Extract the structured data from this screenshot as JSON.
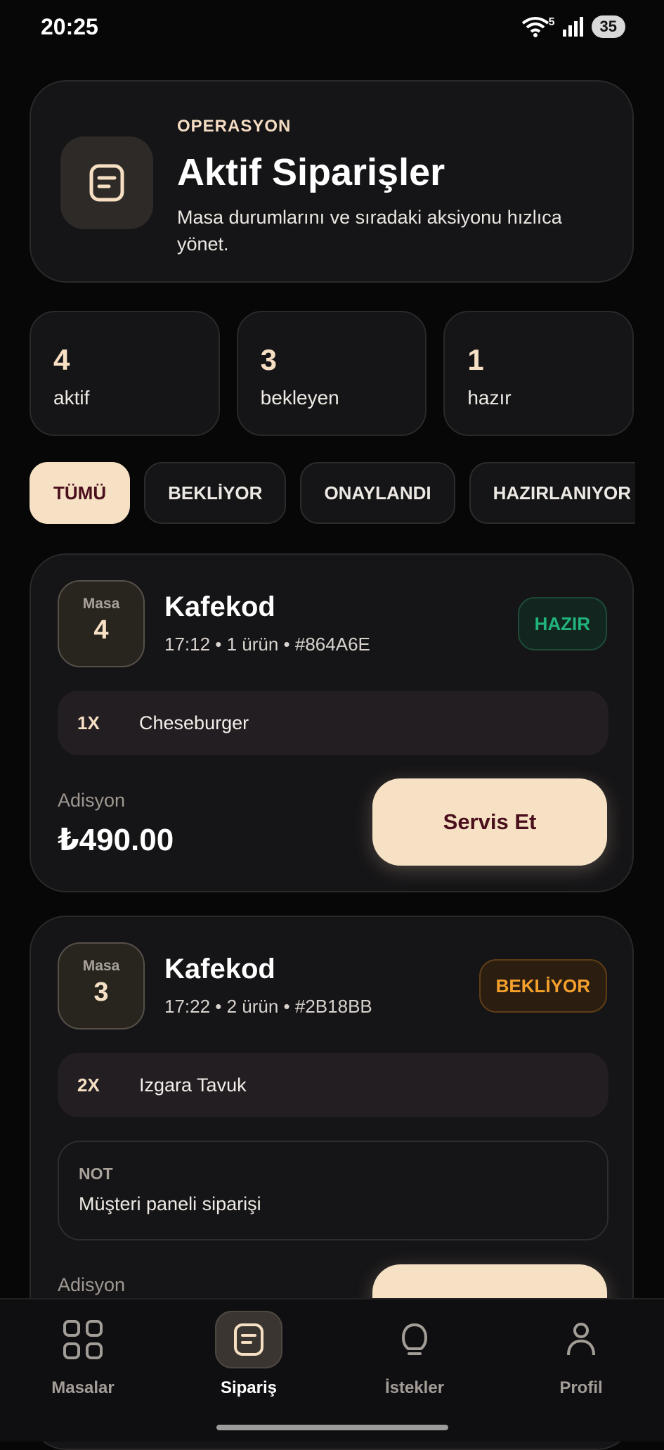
{
  "status_bar": {
    "time": "20:25",
    "network": "5",
    "battery": "35"
  },
  "header": {
    "eyebrow": "OPERASYON",
    "title": "Aktif Siparişler",
    "subtitle": "Masa durumlarını ve sıradaki aksiyonu hızlıca yönet."
  },
  "stats": [
    {
      "value": "4",
      "label": "aktif"
    },
    {
      "value": "3",
      "label": "bekleyen"
    },
    {
      "value": "1",
      "label": "hazır"
    }
  ],
  "filters": [
    {
      "label": "TÜMÜ",
      "active": true
    },
    {
      "label": "BEKLİYOR",
      "active": false
    },
    {
      "label": "ONAYLANDI",
      "active": false
    },
    {
      "label": "HAZIRLANIYOR",
      "active": false
    }
  ],
  "orders": [
    {
      "table_label": "Masa",
      "table_number": "4",
      "name": "Kafekod",
      "meta": "17:12 • 1 ürün • #864A6E",
      "status": "HAZIR",
      "items": [
        {
          "qty": "1X",
          "name": "Cheseburger"
        }
      ],
      "bill_label": "Adisyon",
      "total": "₺490.00",
      "action": "Servis Et"
    },
    {
      "table_label": "Masa",
      "table_number": "3",
      "name": "Kafekod",
      "meta": "17:22 • 2 ürün • #2B18BB",
      "status": "BEKLİYOR",
      "items": [
        {
          "qty": "2X",
          "name": "Izgara Tavuk"
        }
      ],
      "note_label": "NOT",
      "note": "Müşteri paneli siparişi",
      "bill_label": "Adisyon"
    }
  ],
  "nav": [
    {
      "label": "Masalar",
      "icon": "grid-icon",
      "active": false
    },
    {
      "label": "Sipariş",
      "icon": "document-icon",
      "active": true
    },
    {
      "label": "İstekler",
      "icon": "bell-icon",
      "active": false
    },
    {
      "label": "Profil",
      "icon": "person-icon",
      "active": false
    }
  ],
  "colors": {
    "accent": "#f6e1c4",
    "ready": "#21b37c",
    "waiting": "#f5a02c",
    "background": "#070707",
    "card": "#151416"
  }
}
